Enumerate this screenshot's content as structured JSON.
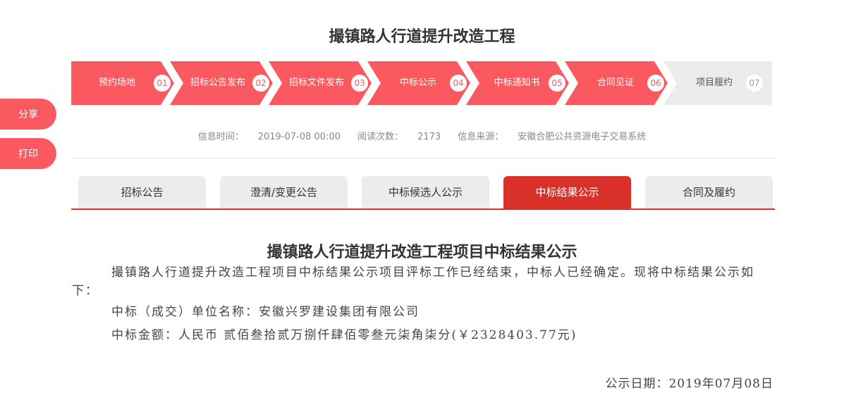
{
  "page_title": "撮镇路人行道提升改造工程",
  "side_buttons": {
    "share": "分享",
    "print": "打印"
  },
  "steps": [
    {
      "label": "预约场地",
      "num": "01"
    },
    {
      "label": "招标公告发布",
      "num": "02"
    },
    {
      "label": "招标文件发布",
      "num": "03"
    },
    {
      "label": "中标公示",
      "num": "04"
    },
    {
      "label": "中标通知书",
      "num": "05"
    },
    {
      "label": "合同见证",
      "num": "06"
    },
    {
      "label": "项目履约",
      "num": "07"
    }
  ],
  "meta": {
    "time_label": "信息时间：",
    "time_value": "2019-07-08 00:00",
    "reads_label": "阅读次数：",
    "reads_value": "2173",
    "source_label": "信息来源：",
    "source_value": "安徽合肥公共资源电子交易系统"
  },
  "tabs": [
    {
      "label": "招标公告"
    },
    {
      "label": "澄清/变更公告"
    },
    {
      "label": "中标候选人公示"
    },
    {
      "label": "中标结果公示"
    },
    {
      "label": "合同及履约"
    }
  ],
  "active_tab": "中标结果公示",
  "document": {
    "title": "撮镇路人行道提升改造工程项目中标结果公示",
    "intro": "撮镇路人行道提升改造工程项目中标结果公示项目评标工作已经结束，中标人已经确定。现将中标结果公示如下：",
    "winner_line": "中标（成交）单位名称：安徽兴罗建设集团有限公司",
    "amount_line": "中标金额：人民币 贰佰叁拾贰万捌仟肆佰零叁元柒角柒分(￥2328403.77元)",
    "date_line": "公示日期：2019年07月08日"
  },
  "colors": {
    "accent": "#fa5a5f",
    "tab_active": "#d9302a",
    "step_inactive": "#ececec"
  }
}
